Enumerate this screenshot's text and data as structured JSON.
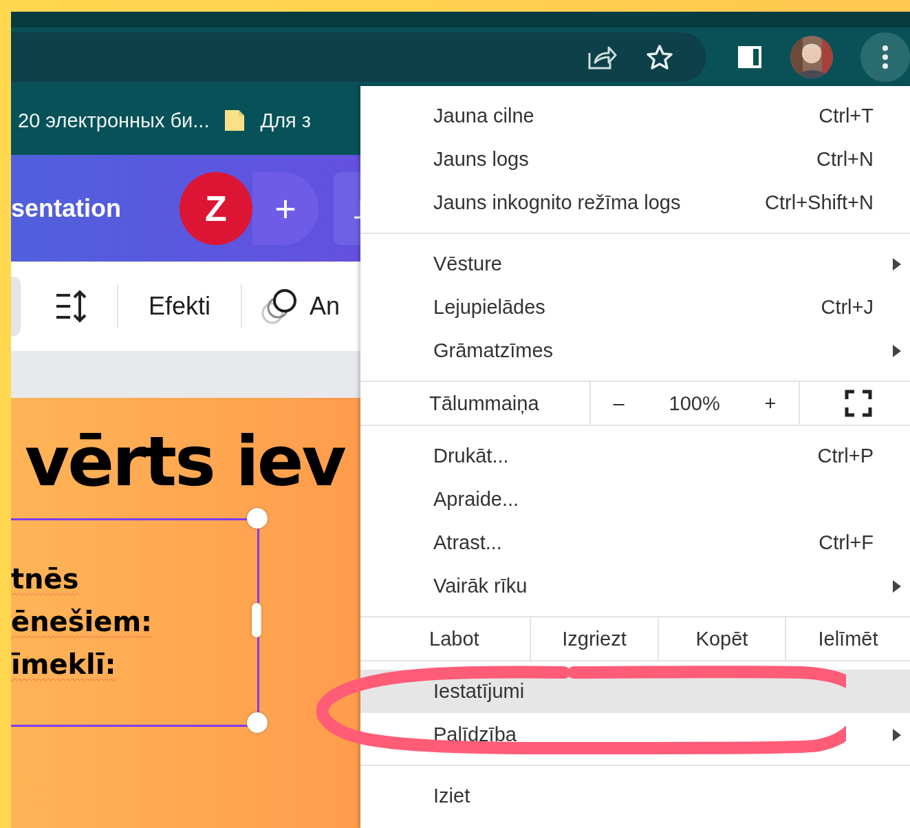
{
  "bookmarks": [
    {
      "kind": "text",
      "label": "20 электронных би..."
    },
    {
      "kind": "folder",
      "label": "Для з"
    }
  ],
  "editor": {
    "title": "sentation",
    "avatar_letter": "Z",
    "add_label": "+",
    "effects": "Efekti",
    "animate": "An"
  },
  "slide": {
    "heading": "vērts iev",
    "lines": [
      "tnēs",
      "ēnešiem:",
      "īmeklī:"
    ]
  },
  "menu": {
    "sections": [
      {
        "items": [
          {
            "kind": "item",
            "label": "Jauna cilne",
            "shortcut": "Ctrl+T",
            "submenu": false,
            "selected": false
          },
          {
            "kind": "item",
            "label": "Jauns logs",
            "shortcut": "Ctrl+N",
            "submenu": false,
            "selected": false
          },
          {
            "kind": "item",
            "label": "Jauns inkognito režīma logs",
            "shortcut": "Ctrl+Shift+N",
            "submenu": false,
            "selected": false
          }
        ]
      },
      {
        "items": [
          {
            "kind": "item",
            "label": "Vēsture",
            "submenu": true,
            "selected": false
          },
          {
            "kind": "item",
            "label": "Lejupielādes",
            "shortcut": "Ctrl+J",
            "submenu": false,
            "selected": false
          },
          {
            "kind": "item",
            "label": "Grāmatzīmes",
            "submenu": true,
            "selected": false
          }
        ]
      },
      {
        "items": [
          {
            "kind": "zoom",
            "label": "Tālummaiņa",
            "minus": "–",
            "value": "100%",
            "plus": "+"
          }
        ]
      },
      {
        "items": [
          {
            "kind": "item",
            "label": "Drukāt...",
            "shortcut": "Ctrl+P",
            "submenu": false,
            "selected": false
          },
          {
            "kind": "item",
            "label": "Apraide...",
            "submenu": false,
            "selected": false
          },
          {
            "kind": "item",
            "label": "Atrast...",
            "shortcut": "Ctrl+F",
            "submenu": false,
            "selected": false
          },
          {
            "kind": "item",
            "label": "Vairāk rīku",
            "submenu": true,
            "selected": false
          }
        ]
      },
      {
        "items": [
          {
            "kind": "edit",
            "label": "Labot",
            "buttons": [
              "Izgriezt",
              "Kopēt",
              "Ielīmēt"
            ]
          }
        ]
      },
      {
        "items": [
          {
            "kind": "item",
            "label": "Iestatījumi",
            "submenu": false,
            "selected": true
          },
          {
            "kind": "item",
            "label": "Palīdzība",
            "submenu": true,
            "selected": false
          }
        ]
      },
      {
        "items": [
          {
            "kind": "item",
            "label": "Iziet",
            "submenu": false,
            "selected": false
          }
        ]
      }
    ]
  }
}
